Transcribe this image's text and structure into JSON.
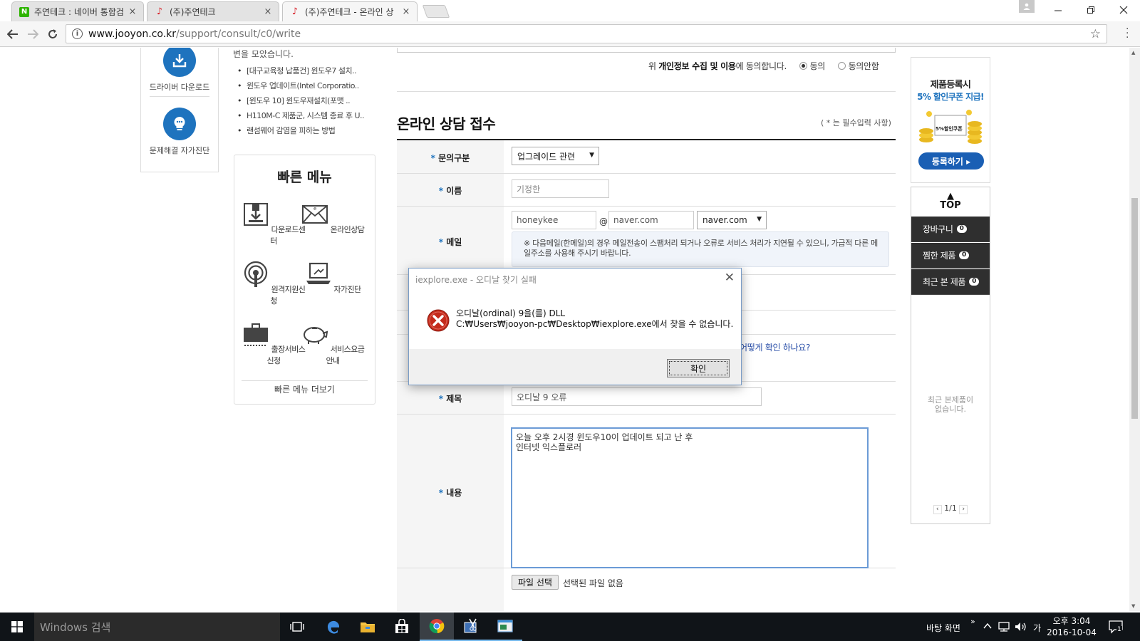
{
  "browser": {
    "tabs": [
      {
        "label": "주연테크 : 네이버 통합검",
        "favicon": "naver-icon",
        "active": false
      },
      {
        "label": "(주)주연테크",
        "favicon": "jooyon-icon",
        "active": false
      },
      {
        "label": "(주)주연테크 - 온라인 상",
        "favicon": "jooyon-icon",
        "active": true
      }
    ],
    "close_glyph": "×",
    "url_host": "www.jooyon.co.kr",
    "url_path": "/support/consult/c0/write"
  },
  "left_tiles": [
    {
      "label": "드라이버 다운로드",
      "icon": "download-tray-icon"
    },
    {
      "label": "문제해결 자가진단",
      "icon": "lightbulb-icon"
    }
  ],
  "faq": {
    "intro": "변을 모았습니다.",
    "items": [
      "[대구교육청 납품건] 윈도우7 설치..",
      "윈도우 업데이트(Intel Corporatio..",
      "[윈도우 10] 윈도우재설치(포맷 ..",
      "H110M-C 제품군, 시스템 종료 후 U..",
      "랜섬웨어 감염을 피하는 방법"
    ]
  },
  "quick_menu": {
    "title": "빠른 메뉴",
    "items": [
      {
        "label": "다운로드센터",
        "icon": "download-box-icon"
      },
      {
        "label": "온라인상담",
        "icon": "envelope-icon"
      },
      {
        "label": "원격지원신청",
        "icon": "remote-signal-icon"
      },
      {
        "label": "자가진단",
        "icon": "laptop-icon"
      },
      {
        "label": "출장서비스신청",
        "icon": "briefcase-icon"
      },
      {
        "label": "서비스요금안내",
        "icon": "piggy-bank-icon"
      }
    ],
    "more": "빠른 메뉴 더보기"
  },
  "privacy": {
    "text_before": "위 ",
    "text_bold": "개인정보 수집 및 이용",
    "text_after": "에 동의합니다.",
    "agree": "동의",
    "disagree": "동의안함",
    "selected": "agree"
  },
  "form": {
    "title": "온라인 상담 접수",
    "required_note": "( * 는 필수입력 사항)",
    "required_mark": "*",
    "labels": {
      "category": "문의구분",
      "name": "이름",
      "email": "메일",
      "subject": "제목",
      "content": "내용"
    },
    "category_value": "업그레이드 관련",
    "name_placeholder": "기정한",
    "email_id": "honeykee",
    "email_at": "@",
    "email_domain": "naver.com",
    "email_domain_select": "naver.com",
    "email_note": "※ 다음메일(한메일)의 경우 메일전송이 스팸처리 되거나 오류로 서비스 처리가 지연될 수 있으니, 가급적 다른 메일주소를 사용해 주시기 바랍니다.",
    "serial_hint": "어떻게 확인 하나요?",
    "subject_value": "오디날 9 오류",
    "content_value": "오늘 오후 2시경 윈도우10이 업데이트 되고 난 후\n인터넷 익스플로러",
    "file_button": "파일 선택",
    "file_status": "선택된 파일 없음"
  },
  "sidebar": {
    "promo_line1": "제품등록시",
    "promo_line2": "5% 할인쿠폰 지급!",
    "coupon_text": "5%할인쿠폰",
    "promo_button": "등록하기 ▸",
    "top": "TOP",
    "cart": "장바구니",
    "cart_count": "0",
    "wish": "찜한 제품",
    "wish_count": "0",
    "recent": "최근 본 제품",
    "recent_count": "0",
    "recent_empty": "최근 본제품이\n없습니다.",
    "pager": "1/1"
  },
  "dialog": {
    "title": "iexplore.exe - 오디날 찾기 실패",
    "message_line1": "오디날(ordinal) 9을(를) DLL",
    "message_line2": "C:₩Users₩jooyon-pc₩Desktop₩iexplore.exe에서 찾을 수 없습니다.",
    "ok": "확인",
    "icon": "error-icon"
  },
  "taskbar": {
    "search_placeholder": "Windows 검색",
    "desktop_label": "바탕 화면",
    "ime": "가",
    "time": "오후 3:04",
    "date": "2016-10-04",
    "notification_count": "1",
    "accent": "#76b9ed"
  }
}
